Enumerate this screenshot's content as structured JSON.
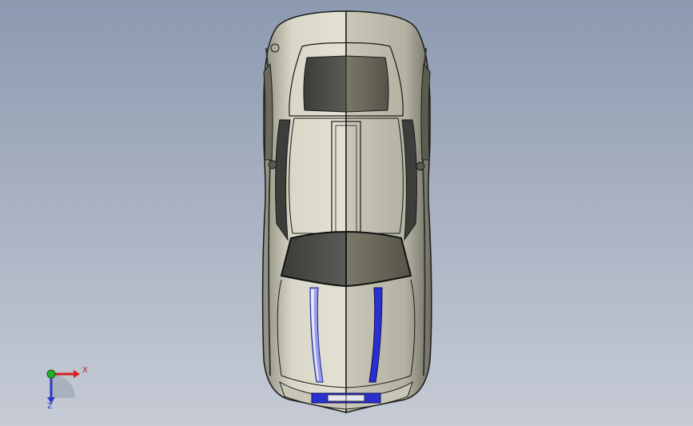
{
  "viewport": {
    "background_top": "#8c99b0",
    "background_bottom": "#c6cbd5"
  },
  "model": {
    "view": "top",
    "body_color": "#d6d5c4",
    "stripe_color": "#2a2fd0",
    "glass_color": "#4d4f4a",
    "edge_color": "#1a1a1a"
  },
  "triad": {
    "x_label": "X",
    "z_label": "Z",
    "x_color": "#d42020",
    "y_color": "#22b02a",
    "z_color": "#2a3acb"
  }
}
